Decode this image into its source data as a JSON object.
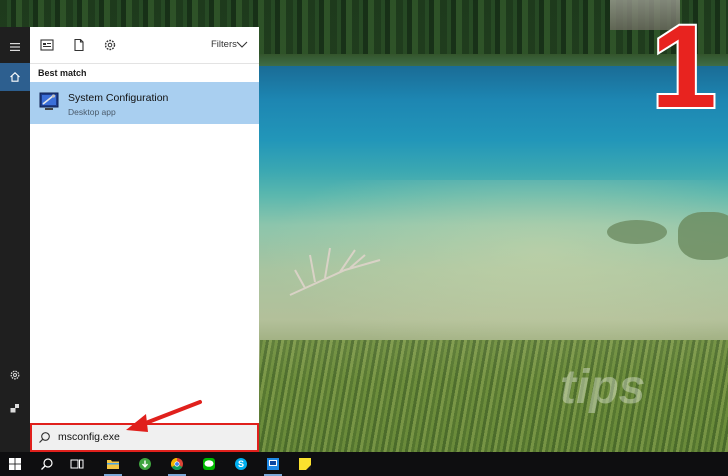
{
  "overlay": {
    "step_number": "1",
    "watermark": "tips"
  },
  "rail": {
    "items": [
      {
        "icon": "hamburger-menu-icon",
        "active": false
      },
      {
        "icon": "home-icon",
        "active": true
      },
      {
        "icon": "gear-icon",
        "active": false
      },
      {
        "icon": "user-icon",
        "active": false
      }
    ]
  },
  "search_panel": {
    "toolbar": {
      "icons": [
        "apps-icon",
        "document-icon",
        "gear-icon"
      ],
      "filters_label": "Filters"
    },
    "section_label": "Best match",
    "result": {
      "title": "System Configuration",
      "subtitle": "Desktop app",
      "icon": "system-configuration-icon"
    },
    "search": {
      "value": "msconfig.exe",
      "icon": "search-icon"
    }
  },
  "taskbar": {
    "items": [
      {
        "icon": "windows-start-icon"
      },
      {
        "icon": "search-icon"
      },
      {
        "icon": "task-view-icon"
      },
      {
        "icon": "file-explorer-icon"
      },
      {
        "icon": "download-app-icon"
      },
      {
        "icon": "chrome-icon"
      },
      {
        "icon": "line-app-icon"
      },
      {
        "icon": "skype-icon"
      },
      {
        "icon": "photo-app-icon"
      },
      {
        "icon": "sticky-notes-icon"
      }
    ]
  },
  "colors": {
    "accent_red": "#e0201c",
    "selection": "#a9cff0",
    "rail_active": "#2d5f8f"
  }
}
